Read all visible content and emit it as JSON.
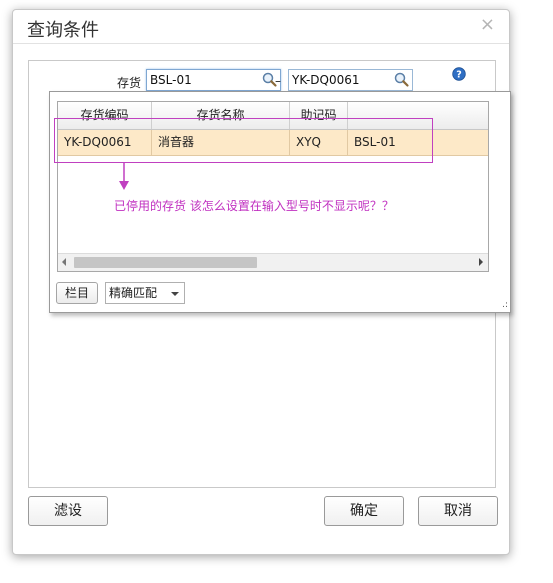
{
  "dialog": {
    "title": "查询条件",
    "close_glyph": "×"
  },
  "query": {
    "field_label": "存货",
    "from_value": "BSL-01",
    "range_separator": "–",
    "to_value": "YK-DQ0061",
    "search_icon": "magnifier-icon",
    "help_icon": "help-icon"
  },
  "grid": {
    "columns": [
      "存货编码",
      "存货名称",
      "助记码",
      ""
    ],
    "rows": [
      [
        "YK-DQ0061",
        "消音器",
        "XYQ",
        "BSL-01"
      ]
    ],
    "selected_row_color": "#fde9c8"
  },
  "popup_footer": {
    "column_button": "栏目",
    "match_mode": "精确匹配"
  },
  "annotation": {
    "text": "已停用的存货  该怎么设置在输入型号时不显示呢？？",
    "color": "#c030c0"
  },
  "footer": {
    "filter_button": "滤设",
    "ok_button": "确定",
    "cancel_button": "取消"
  }
}
